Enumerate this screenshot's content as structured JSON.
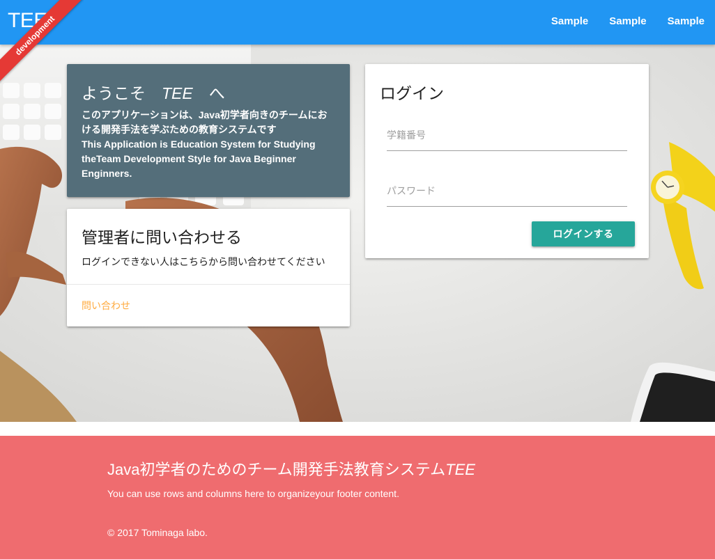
{
  "navbar": {
    "brand": "TEE",
    "ribbon": "development",
    "links": [
      "Sample",
      "Sample",
      "Sample"
    ]
  },
  "welcome": {
    "title_prefix": "ようこそ　",
    "title_name": "TEE",
    "title_suffix": "　へ",
    "lines": [
      "このアプリケーションは、Java初学者向きのチームにお",
      "ける開発手法を学ぶための教育システムです",
      "This Application is Education System for Studying",
      "theTeam Development Style for Java Beginner",
      "Enginners."
    ]
  },
  "contact": {
    "title": "管理者に問い合わせる",
    "text": "ログインできない人はこちらから問い合わせてください",
    "link": "問い合わせ"
  },
  "login": {
    "title": "ログイン",
    "student_id_placeholder": "学籍番号",
    "password_placeholder": "パスワード",
    "button": "ログインする"
  },
  "footer": {
    "title_prefix": "Java初学者のためのチーム開発手法教育システム",
    "title_name": "TEE",
    "text": "You can use rows and columns here to organizeyour footer content.",
    "copyright": "© 2017 Tominaga labo."
  },
  "colors": {
    "navbar": "#2196f3",
    "ribbon": "#e53935",
    "welcome_card": "#546e7a",
    "login_button": "#26a69a",
    "contact_link": "#ffab40",
    "footer": "#ef6c6f"
  }
}
